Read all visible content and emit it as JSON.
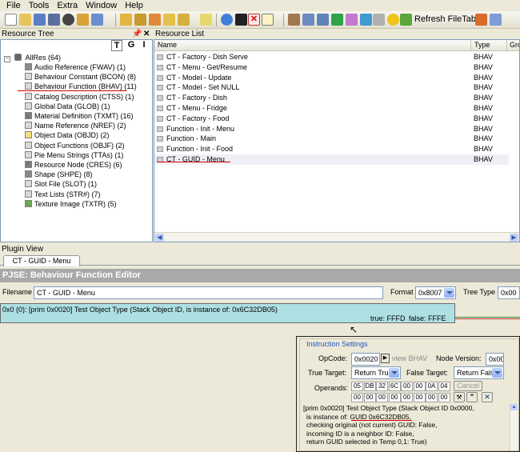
{
  "menu": [
    "File",
    "Tools",
    "Extra",
    "Window",
    "Help"
  ],
  "toolbar": {
    "refresh_label": "Refresh FileTable"
  },
  "resource_tree": {
    "title": "Resource Tree",
    "view_buttons": [
      "T",
      "G",
      "I"
    ],
    "root": "AllRes (64)",
    "items": [
      {
        "label": "Audio Reference (FWAV) (1)",
        "icon": "audio-icon",
        "color": "#8a8a8a"
      },
      {
        "label": "Behaviour Constant (BCON) (8)",
        "icon": "document-icon",
        "color": "#d9d9d9"
      },
      {
        "label": "Behaviour Function (BHAV) (11)",
        "icon": "document-icon",
        "color": "#d9d9d9"
      },
      {
        "label": "Catalog Description (CTSS) (1)",
        "icon": "document-icon",
        "color": "#d9d9d9"
      },
      {
        "label": "Global Data (GLOB) (1)",
        "icon": "document-icon",
        "color": "#d9d9d9"
      },
      {
        "label": "Material Definition (TXMT) (16)",
        "icon": "material-icon",
        "color": "#7a7a7a"
      },
      {
        "label": "Name Reference (NREF) (2)",
        "icon": "document-icon",
        "color": "#d9d9d9"
      },
      {
        "label": "Object Data (OBJD) (2)",
        "icon": "object-icon",
        "color": "#f5e27a"
      },
      {
        "label": "Object Functions (OBJF) (2)",
        "icon": "document-icon",
        "color": "#d9d9d9"
      },
      {
        "label": "Pie Menu Strings (TTAs) (1)",
        "icon": "document-icon",
        "color": "#d9d9d9"
      },
      {
        "label": "Resource Node (CRES) (6)",
        "icon": "node-icon",
        "color": "#7a7a7a"
      },
      {
        "label": "Shape (SHPE) (8)",
        "icon": "shape-icon",
        "color": "#8a8a8a"
      },
      {
        "label": "Slot File (SLOT) (1)",
        "icon": "document-icon",
        "color": "#d9d9d9"
      },
      {
        "label": "Text Lists (STR#) (7)",
        "icon": "document-icon",
        "color": "#d9d9d9"
      },
      {
        "label": "Texture Image (TXTR) (5)",
        "icon": "image-icon",
        "color": "#6aa84f"
      }
    ]
  },
  "resource_list": {
    "title": "Resource List",
    "columns": [
      "Name",
      "Type",
      "Gro"
    ],
    "rows": [
      {
        "name": "CT - Factory - Dish Serve",
        "type": "BHAV"
      },
      {
        "name": "CT - Menu - Get/Resume",
        "type": "BHAV"
      },
      {
        "name": "CT - Model - Update",
        "type": "BHAV"
      },
      {
        "name": "CT - Model - Set NULL",
        "type": "BHAV"
      },
      {
        "name": "CT - Factory - Dish",
        "type": "BHAV"
      },
      {
        "name": "CT - Menu - Fridge",
        "type": "BHAV"
      },
      {
        "name": "CT - Factory - Food",
        "type": "BHAV"
      },
      {
        "name": "Function - Init - Menu",
        "type": "BHAV"
      },
      {
        "name": "Function - Main",
        "type": "BHAV"
      },
      {
        "name": "Function - Init - Food",
        "type": "BHAV"
      },
      {
        "name": "CT - GUID - Menu",
        "type": "BHAV"
      }
    ]
  },
  "plugin_view": {
    "title": "Plugin View",
    "tab": "CT - GUID - Menu",
    "editor_title": "PJSE: Behaviour Function Editor",
    "filename_label": "Filename",
    "filename_value": "CT - GUID - Menu",
    "format_label": "Format",
    "format_value": "0x8007",
    "tree_type_label": "Tree Type",
    "tree_type_value": "0x00",
    "node_text": "0x0 (0): [prim 0x0020] Test Object Type (Stack Object ID, is instance of: 0x6C32DB05)",
    "node_true": "true: FFFD",
    "node_false": "false: FFFE"
  },
  "instruction": {
    "title": "Instruction Settings",
    "opcode_label": "OpCode:",
    "opcode_value": "0x0020",
    "view_bhav": "view BHAV",
    "node_version_label": "Node Version:",
    "node_version_value": "0x00",
    "true_target_label": "True Target:",
    "true_target_value": "Return True",
    "false_target_label": "False Target:",
    "false_target_value": "Return False",
    "operands_label": "Operands:",
    "operands_row1": [
      "05",
      "DB",
      "32",
      "6C",
      "00",
      "00",
      "0A",
      "04"
    ],
    "operands_row2": [
      "00",
      "00",
      "00",
      "00",
      "00",
      "00",
      "00",
      "00"
    ],
    "cancel_label": "Cancel",
    "desc_lines": [
      "[prim 0x0020] Test Object Type (Stack Object ID 0x0000,",
      "is instance of: GUID 0x6C32DB05,",
      "checking original (not current) GUID: False,",
      "incoming ID is a neighbor ID: False,",
      "return GUID selected in Temp 0,1: True)"
    ]
  }
}
